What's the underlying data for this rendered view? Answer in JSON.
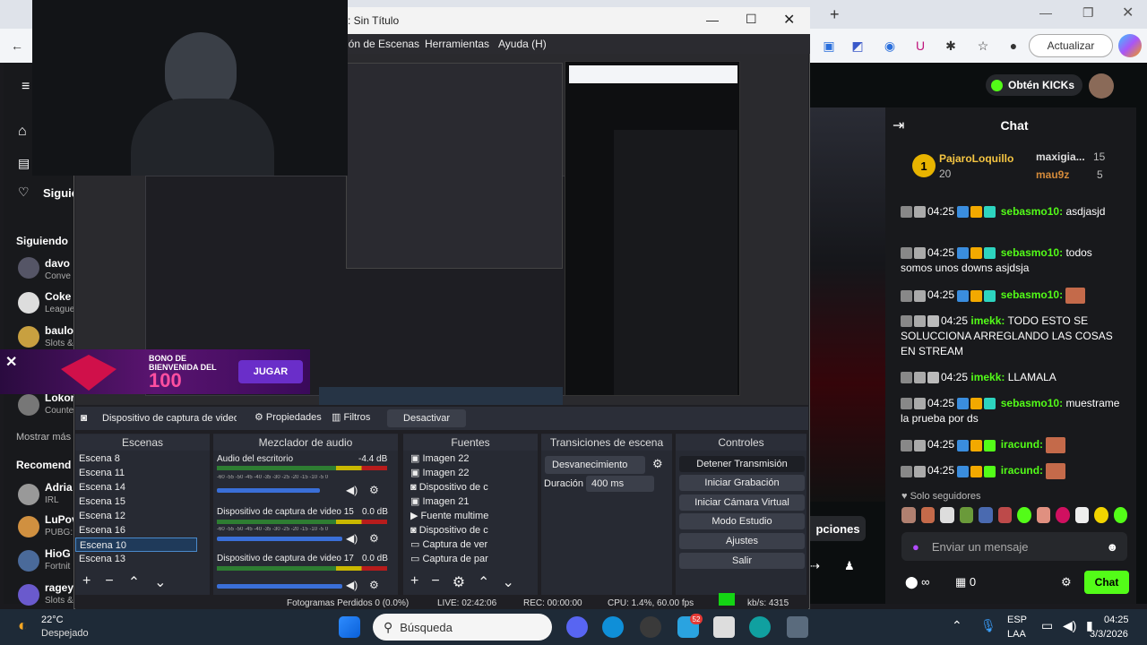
{
  "browser": {
    "update_label": "Actualizar"
  },
  "kick": {
    "get_kicks": "Obtén KICKs",
    "sidebar": {
      "following_short": "Siguie",
      "following": "Siguiendo",
      "show_more": "Mostrar más",
      "recommended": "Recomend",
      "channels": [
        {
          "name": "davo",
          "sub": "Conve"
        },
        {
          "name": "Coke",
          "sub": "League"
        },
        {
          "name": "baulo",
          "sub": "Slots &"
        },
        {
          "name": "Lokor",
          "sub": "Counte"
        },
        {
          "name": "Adria",
          "sub": "IRL"
        },
        {
          "name": "LuPov",
          "sub": "PUBG:"
        },
        {
          "name": "HioG",
          "sub": "Fortnit"
        },
        {
          "name": "ragey",
          "sub": "Slots &"
        }
      ]
    },
    "chat": {
      "title": "Chat",
      "top": [
        {
          "name": "PajaroLoquillo",
          "count": "20"
        },
        {
          "name": "maxigia...",
          "count": "15"
        },
        {
          "name": "mau9z",
          "count": "5"
        }
      ],
      "messages": [
        {
          "time": "04:25",
          "user": "sebasmo10:",
          "text": "asdjasjd"
        },
        {
          "time": "04:25",
          "user": "sebasmo10:",
          "text": "todos somos unos downs asjdsja"
        },
        {
          "time": "04:25",
          "user": "sebasmo10:",
          "text": ""
        },
        {
          "time": "04:25",
          "user": "imekk:",
          "text": "TODO ESTO SE SOLUCCIONA ARREGLANDO LAS COSAS EN STREAM"
        },
        {
          "time": "04:25",
          "user": "imekk:",
          "text": "LLAMALA"
        },
        {
          "time": "04:25",
          "user": "sebasmo10:",
          "text": "muestrame la prueba por ds"
        },
        {
          "time": "04:25",
          "user": "iracund:",
          "text": ""
        },
        {
          "time": "04:25",
          "user": "iracund:",
          "text": ""
        }
      ],
      "followers_only": "Solo seguidores",
      "input_placeholder": "Enviar un mensaje",
      "infinity": "∞",
      "zero": "0",
      "send": "Chat",
      "options": "pciones"
    },
    "banner": {
      "line1": "BONO DE",
      "line2": "BIENVENIDA DEL",
      "amount": "100",
      "play": "JUGAR"
    }
  },
  "obs": {
    "title": "s: Sin Título",
    "menu": [
      "ión de Escenas",
      "Herramientas",
      "Ayuda (H)"
    ],
    "source_toolbar": {
      "device": "Dispositivo de captura de video 1",
      "properties": "Propiedades",
      "filters": "Filtros",
      "deactivate": "Desactivar"
    },
    "scenes": {
      "title": "Escenas",
      "items": [
        "Escena 8",
        "Escena 11",
        "Escena 14",
        "Escena 15",
        "Escena 12",
        "Escena 16",
        "Escena 10",
        "Escena 13"
      ],
      "selected": "Escena 10"
    },
    "mixer": {
      "title": "Mezclador de audio",
      "channels": [
        {
          "name": "Audio del escritorio",
          "db": "-4.4 dB",
          "level": 0.75
        },
        {
          "name": "Dispositivo de captura de video 15",
          "db": "0.0 dB",
          "level": 0.95
        },
        {
          "name": "Dispositivo de captura de video 17",
          "db": "0.0 dB",
          "level": 0.95
        }
      ],
      "scale": "-60 -55 -50 -45 -40 -35 -30 -25 -20 -15 -10 -5 0"
    },
    "sources": {
      "title": "Fuentes",
      "items": [
        "Imagen 22",
        "Imagen 22",
        "Dispositivo de c",
        "Imagen 21",
        "Fuente multime",
        "Dispositivo de c",
        "Captura de ver",
        "Captura de par"
      ]
    },
    "transitions": {
      "title": "Transiciones de escena",
      "type": "Desvanecimiento",
      "duration_label": "Duración",
      "duration": "400 ms"
    },
    "controls": {
      "title": "Controles",
      "buttons": [
        "Detener Transmisión",
        "Iniciar Grabación",
        "Iniciar Cámara Virtual",
        "Modo Estudio",
        "Ajustes",
        "Salir"
      ]
    },
    "status": {
      "dropped": "Fotogramas Perdidos 0 (0.0%)",
      "live": "LIVE: 02:42:06",
      "rec": "REC: 00:00:00",
      "cpu": "CPU: 1.4%, 60.00 fps",
      "kbs": "kb/s: 4315"
    }
  },
  "taskbar": {
    "weather_temp": "22°C",
    "weather_desc": "Despejado",
    "search": "Búsqueda",
    "lang1": "ESP",
    "lang2": "LAA",
    "time": "04:25",
    "date": "3/3/2026",
    "badge": "52"
  },
  "colors": {
    "kick_green": "#53fc18",
    "obs_bg": "#1f1f24",
    "taskbar": "#1e2a37"
  }
}
